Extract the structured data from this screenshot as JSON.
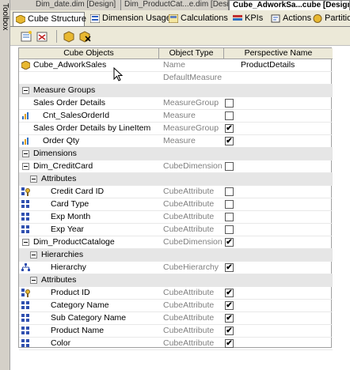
{
  "toolbox": {
    "label": "Toolbox"
  },
  "doc_tabs": [
    {
      "label": "Dim_date.dim [Design]"
    },
    {
      "label": "Dim_ProductCat...e.dim [Design]"
    },
    {
      "label": "Cube_AdworkSa...cube [Design]"
    }
  ],
  "view_tabs": [
    {
      "label": "Cube Structure"
    },
    {
      "label": "Dimension Usage"
    },
    {
      "label": "Calculations"
    },
    {
      "label": "KPIs"
    },
    {
      "label": "Actions"
    },
    {
      "label": "Partitions"
    }
  ],
  "grid": {
    "headers": {
      "objects": "Cube Objects",
      "type": "Object Type",
      "perspective": "Perspective Name"
    },
    "cube_name": "Cube_AdworkSales",
    "name_type": "Name",
    "perspective_name": "ProductDetails",
    "default_measure": "DefaultMeasure",
    "rows": [
      {
        "label": "Measure Groups",
        "type": "",
        "checked": null
      },
      {
        "label": "Sales Order Details",
        "type": "MeasureGroup",
        "checked": false
      },
      {
        "label": "Cnt_SalesOrderId",
        "type": "Measure",
        "checked": false
      },
      {
        "label": "Sales Order Details by LineItem",
        "type": "MeasureGroup",
        "checked": true
      },
      {
        "label": "Order Qty",
        "type": "Measure",
        "checked": true
      },
      {
        "label": "Dimensions",
        "type": "",
        "checked": null
      },
      {
        "label": "Dim_CreditCard",
        "type": "CubeDimension",
        "checked": false
      },
      {
        "label": "Attributes",
        "type": "",
        "checked": null
      },
      {
        "label": "Credit Card ID",
        "type": "CubeAttribute",
        "checked": false
      },
      {
        "label": "Card Type",
        "type": "CubeAttribute",
        "checked": false
      },
      {
        "label": "Exp Month",
        "type": "CubeAttribute",
        "checked": false
      },
      {
        "label": "Exp Year",
        "type": "CubeAttribute",
        "checked": false
      },
      {
        "label": "Dim_ProductCataloge",
        "type": "CubeDimension",
        "checked": true
      },
      {
        "label": "Hierarchies",
        "type": "",
        "checked": null
      },
      {
        "label": "Hierarchy",
        "type": "CubeHierarchy",
        "checked": true
      },
      {
        "label": "Attributes",
        "type": "",
        "checked": null
      },
      {
        "label": "Product ID",
        "type": "CubeAttribute",
        "checked": true
      },
      {
        "label": "Category Name",
        "type": "CubeAttribute",
        "checked": true
      },
      {
        "label": "Sub Category Name",
        "type": "CubeAttribute",
        "checked": true
      },
      {
        "label": "Product Name",
        "type": "CubeAttribute",
        "checked": true
      },
      {
        "label": "Color",
        "type": "CubeAttribute",
        "checked": true
      }
    ]
  }
}
